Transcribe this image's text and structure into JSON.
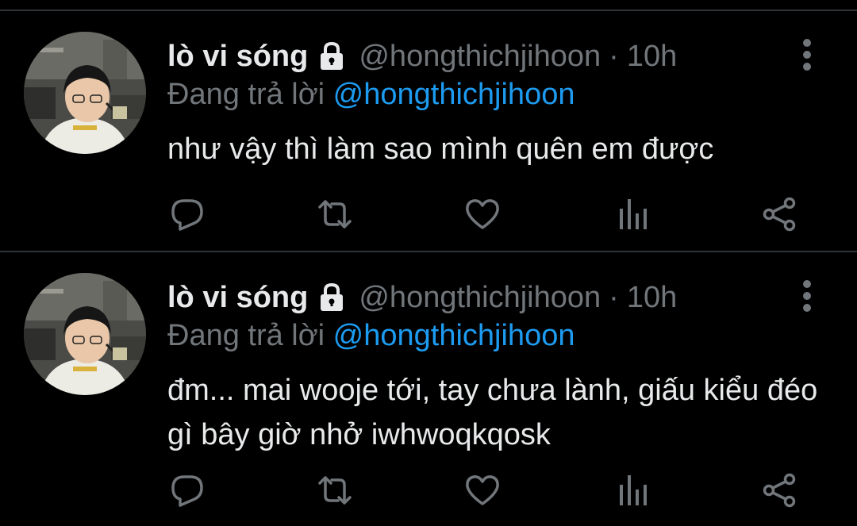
{
  "colors": {
    "background": "#000000",
    "divider": "#2f3336",
    "primary_text": "#e7e9ea",
    "secondary_text": "#71767b",
    "link": "#1d9bf0"
  },
  "icons": {
    "protected": "lock-icon",
    "more": "more-vertical-icon",
    "reply": "reply-icon",
    "retweet": "retweet-icon",
    "like": "heart-icon",
    "views": "analytics-icon",
    "share": "share-icon"
  },
  "tweets": [
    {
      "display_name": "lò vi sóng",
      "handle": "@hongthichjihoon",
      "separator": "·",
      "time": "10h",
      "reply_prefix": "Đang trả lời",
      "reply_to": "@hongthichjihoon",
      "text": "như vậy thì làm sao mình quên em được"
    },
    {
      "display_name": "lò vi sóng",
      "handle": "@hongthichjihoon",
      "separator": "·",
      "time": "10h",
      "reply_prefix": "Đang trả lời",
      "reply_to": "@hongthichjihoon",
      "text": "đm... mai wooje tới, tay chưa lành, giấu kiểu đéo gì bây giờ nhở iwhwoqkqosk"
    }
  ]
}
